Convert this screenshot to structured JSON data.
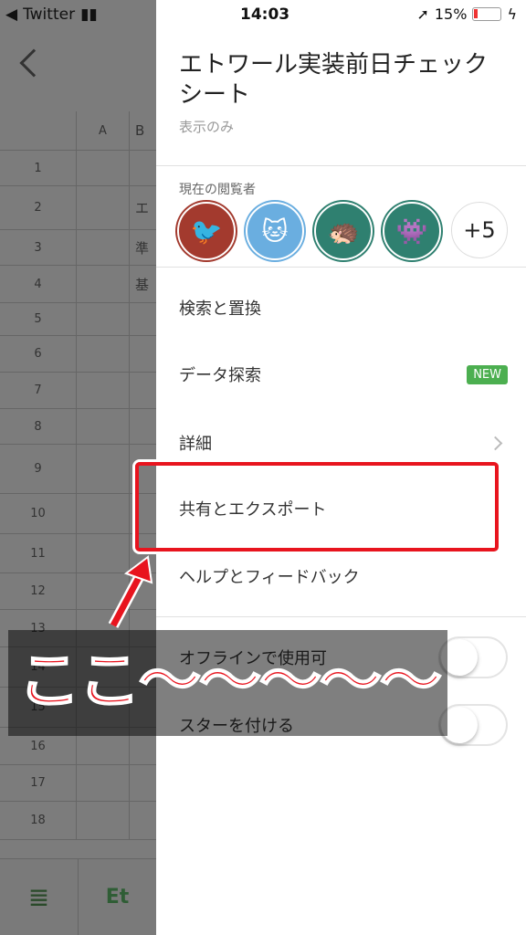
{
  "status": {
    "back_app": "Twitter",
    "time": "14:03",
    "battery": "15%"
  },
  "sheet": {
    "column_headers": [
      "A",
      "B"
    ],
    "rows": [
      {
        "n": "1",
        "b": ""
      },
      {
        "n": "2",
        "b": "エ"
      },
      {
        "n": "3",
        "b": "準"
      },
      {
        "n": "4",
        "b": "基"
      },
      {
        "n": "5",
        "b": ""
      },
      {
        "n": "6",
        "b": ""
      },
      {
        "n": "7",
        "b": ""
      },
      {
        "n": "8",
        "b": ""
      },
      {
        "n": "9",
        "b": ""
      },
      {
        "n": "10",
        "b": ""
      },
      {
        "n": "11",
        "b": ""
      },
      {
        "n": "12",
        "b": ""
      },
      {
        "n": "13",
        "b": ""
      },
      {
        "n": "14",
        "b": ""
      },
      {
        "n": "15",
        "b": ""
      },
      {
        "n": "16",
        "b": ""
      },
      {
        "n": "17",
        "b": ""
      },
      {
        "n": "18",
        "b": ""
      }
    ],
    "sheet_tab": "Et"
  },
  "panel": {
    "title": "エトワール実装前日チェックシート",
    "subtitle": "表示のみ",
    "viewers_label": "現在の閲覧者",
    "viewers": [
      {
        "icon": "bird-icon",
        "color": "#a33a2e"
      },
      {
        "icon": "cat-icon",
        "color": "#6aaee0"
      },
      {
        "icon": "hedgehog-icon",
        "color": "#2f8070"
      },
      {
        "icon": "monster-icon",
        "color": "#2f8070"
      }
    ],
    "more_viewers": "+5",
    "menu": [
      {
        "label": "検索と置換"
      },
      {
        "label": "データ探索",
        "badge": "NEW"
      },
      {
        "label": "詳細"
      },
      {
        "label": "共有とエクスポート"
      },
      {
        "label": "ヘルプとフィードバック"
      }
    ],
    "toggles": [
      {
        "label": "オフラインで使用可",
        "on": false
      },
      {
        "label": "スターを付ける",
        "on": false
      }
    ]
  },
  "annotation": {
    "text": "ここ〜〜〜〜〜",
    "color": "#e8141e"
  }
}
